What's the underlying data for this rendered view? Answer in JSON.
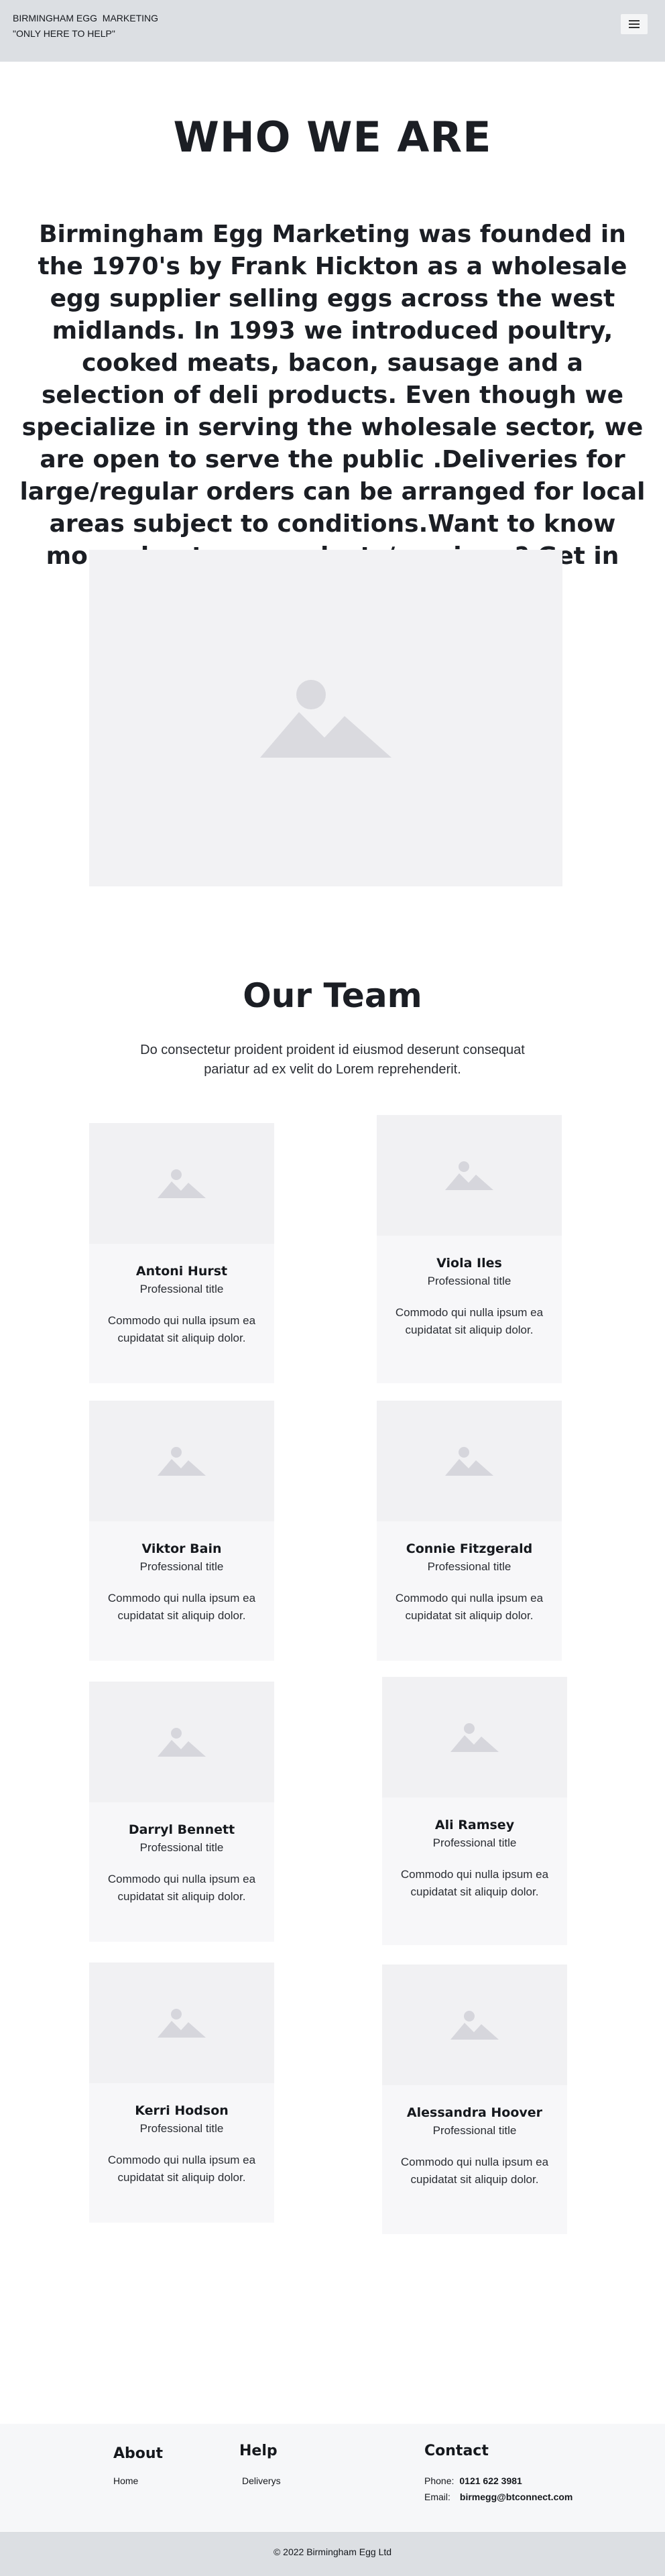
{
  "header": {
    "brand_line1": "BIRMINGHAM EGG  MARKETING",
    "brand_line2": "\"ONLY HERE TO HELP\"",
    "menu_icon": "hamburger-icon"
  },
  "about": {
    "title": "WHO WE ARE",
    "paragraph": "Birmingham Egg Marketing was founded in the 1970's by Frank Hickton as a wholesale egg supplier selling eggs across the west midlands. In 1993 we introduced poultry, cooked meats, bacon, sausage and a selection of deli products. Even though we specialize in serving the wholesale sector, we are open to serve the public .Deliveries for large/regular orders can be arranged for local areas subject to conditions.Want to know more about our products/services ? Get in touch with us today...",
    "image_icon": "image-placeholder-icon"
  },
  "team": {
    "title": "Our Team",
    "subtitle": "Do consectetur proident proident id eiusmod deserunt consequat pariatur ad ex velit do Lorem reprehenderit.",
    "members": [
      {
        "name": "Antoni Hurst",
        "role": "Professional title",
        "bio": "Commodo qui nulla ipsum ea cupidatat sit aliquip dolor."
      },
      {
        "name": "Viola Iles",
        "role": "Professional title",
        "bio": "Commodo qui nulla ipsum ea cupidatat sit aliquip dolor."
      },
      {
        "name": "Viktor Bain",
        "role": "Professional title",
        "bio": "Commodo qui nulla ipsum ea cupidatat sit aliquip dolor."
      },
      {
        "name": "Connie Fitzgerald",
        "role": "Professional title",
        "bio": "Commodo qui nulla ipsum ea cupidatat sit aliquip dolor."
      },
      {
        "name": "Darryl Bennett",
        "role": "Professional title",
        "bio": "Commodo qui nulla ipsum ea cupidatat sit aliquip dolor."
      },
      {
        "name": "Ali Ramsey",
        "role": "Professional title",
        "bio": "Commodo qui nulla ipsum ea cupidatat sit aliquip dolor."
      },
      {
        "name": "Kerri Hodson",
        "role": "Professional title",
        "bio": "Commodo qui nulla ipsum ea cupidatat sit aliquip dolor."
      },
      {
        "name": "Alessandra Hoover",
        "role": "Professional title",
        "bio": "Commodo qui nulla ipsum ea cupidatat sit aliquip dolor."
      }
    ]
  },
  "footer": {
    "about_title": "About",
    "about_link": "Home",
    "help_title": "Help",
    "help_link": "Deliverys",
    "contact_title": "Contact",
    "phone_label": "Phone:",
    "phone_value": "0121 622 3981",
    "email_label": "Email:",
    "email_value": "birmegg@btconnect.com",
    "copyright": "© 2022 Birmingham Egg Ltd"
  },
  "colors": {
    "header_bg": "#dcdfe3",
    "text_dark": "#1b1e24",
    "card_bg": "#f7f7f9",
    "placeholder_bg": "#f1f1f3",
    "footer_bg": "#f6f7f9"
  }
}
